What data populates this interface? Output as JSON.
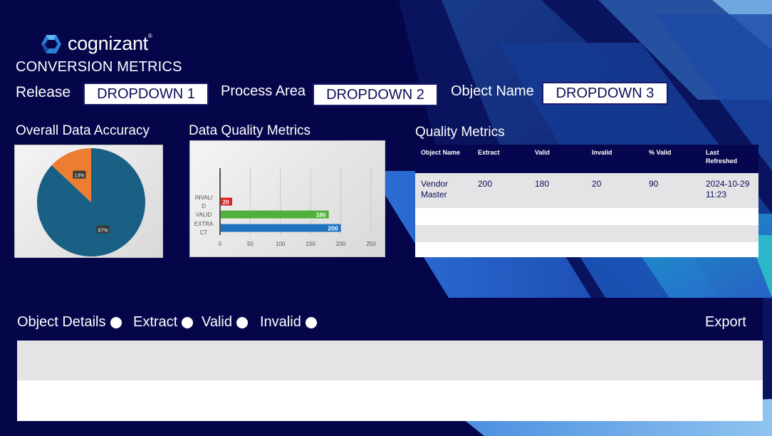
{
  "brand": {
    "logo_text": "cognizant",
    "tm": "®"
  },
  "app_title": "CONVERSION METRICS",
  "filters": {
    "release": {
      "label": "Release",
      "value": "DROPDOWN 1"
    },
    "process_area": {
      "label": "Process Area",
      "value": "DROPDOWN 2"
    },
    "object_name": {
      "label": "Object Name",
      "value": "DROPDOWN 3"
    }
  },
  "overall_accuracy": {
    "title": "Overall Data Accuracy",
    "chart_data": {
      "type": "pie",
      "labels": [
        "13%",
        "87%"
      ],
      "values": [
        13,
        87
      ],
      "colors": [
        "#ed7d31",
        "#1a6085"
      ]
    }
  },
  "dq_metrics": {
    "title": "Data Quality Metrics",
    "chart_data": {
      "type": "bar",
      "orientation": "horizontal",
      "categories": [
        "INVALID",
        "VALID",
        "EXTRACT"
      ],
      "category_lines": [
        [
          "INVALI",
          "D"
        ],
        [
          "VALID"
        ],
        [
          "EXTRA",
          "CT"
        ]
      ],
      "values": [
        20,
        180,
        200
      ],
      "data_labels": [
        "20",
        "180",
        "200"
      ],
      "colors": [
        "#e02020",
        "#4fb03a",
        "#1e73c0"
      ],
      "xlim": [
        0,
        250
      ],
      "xticks": [
        "0",
        "50",
        "100",
        "150",
        "200",
        "250"
      ],
      "grid": true
    }
  },
  "quality_metrics": {
    "title": "Quality Metrics",
    "columns": [
      "Object Name",
      "Extract",
      "Valid",
      "Invalid",
      "% Valid",
      "Last Refreshed"
    ],
    "rows": [
      [
        "Vendor Master",
        "200",
        "180",
        "20",
        "90",
        "2024-10-29 11:23"
      ]
    ]
  },
  "object_details": {
    "label": "Object Details",
    "options": [
      "Extract",
      "Valid",
      "Invalid"
    ],
    "export_label": "Export"
  },
  "colors": {
    "navy": "#05054a",
    "pie_blue": "#1a6085",
    "pie_orange": "#ed7d31"
  }
}
